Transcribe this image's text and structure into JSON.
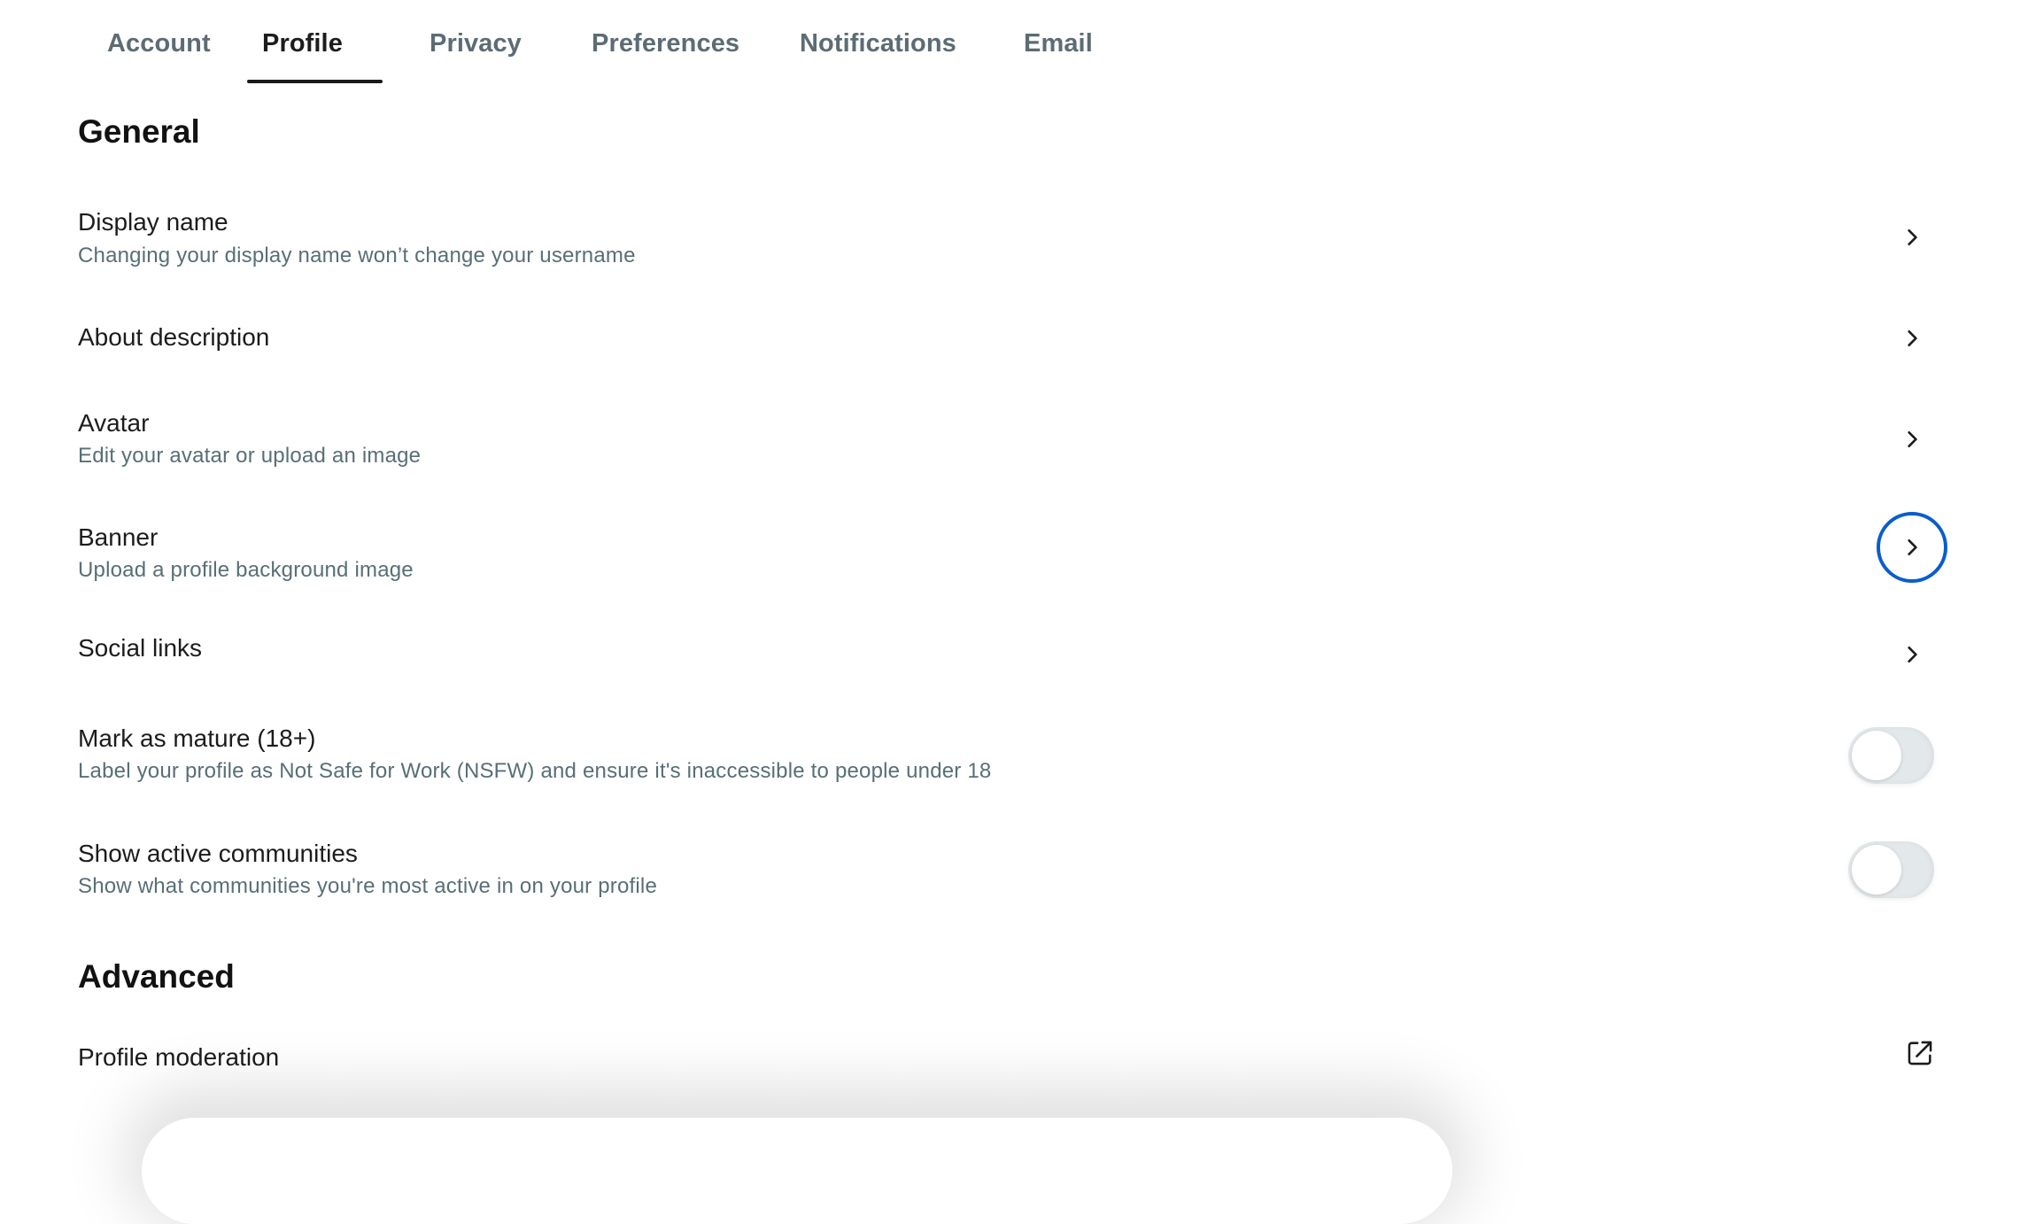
{
  "tabs": [
    {
      "label": "Account",
      "active": false
    },
    {
      "label": "Profile",
      "active": true
    },
    {
      "label": "Privacy",
      "active": false
    },
    {
      "label": "Preferences",
      "active": false
    },
    {
      "label": "Notifications",
      "active": false
    },
    {
      "label": "Email",
      "active": false
    }
  ],
  "sections": {
    "general": {
      "heading": "General",
      "rows": [
        {
          "title": "Display name",
          "description": "Changing your display name won’t change your username",
          "control": "chevron-icon"
        },
        {
          "title": "About description",
          "description": "",
          "control": "chevron-icon"
        },
        {
          "title": "Avatar",
          "description": "Edit your avatar or upload an image",
          "control": "chevron-icon"
        },
        {
          "title": "Banner",
          "description": "Upload a profile background image",
          "control": "chevron-icon",
          "focused": true
        },
        {
          "title": "Social links",
          "description": "",
          "control": "chevron-icon"
        },
        {
          "title": "Mark as mature (18+)",
          "description": "Label your profile as Not Safe for Work (NSFW) and ensure it's inaccessible to people under 18",
          "control": "toggle",
          "checked": false
        },
        {
          "title": "Show active communities",
          "description": "Show what communities you're most active in on your profile",
          "control": "toggle",
          "checked": false
        }
      ]
    },
    "advanced": {
      "heading": "Advanced",
      "rows": [
        {
          "title": "Profile moderation",
          "description": "",
          "control": "external-link-icon"
        }
      ]
    }
  },
  "colors": {
    "focus_ring": "#0a5dcd",
    "tab_inactive": "#5c6c74",
    "tab_active": "#1c1c1c",
    "description_text": "#576f76",
    "toggle_track_off": "#e3e8eb"
  }
}
